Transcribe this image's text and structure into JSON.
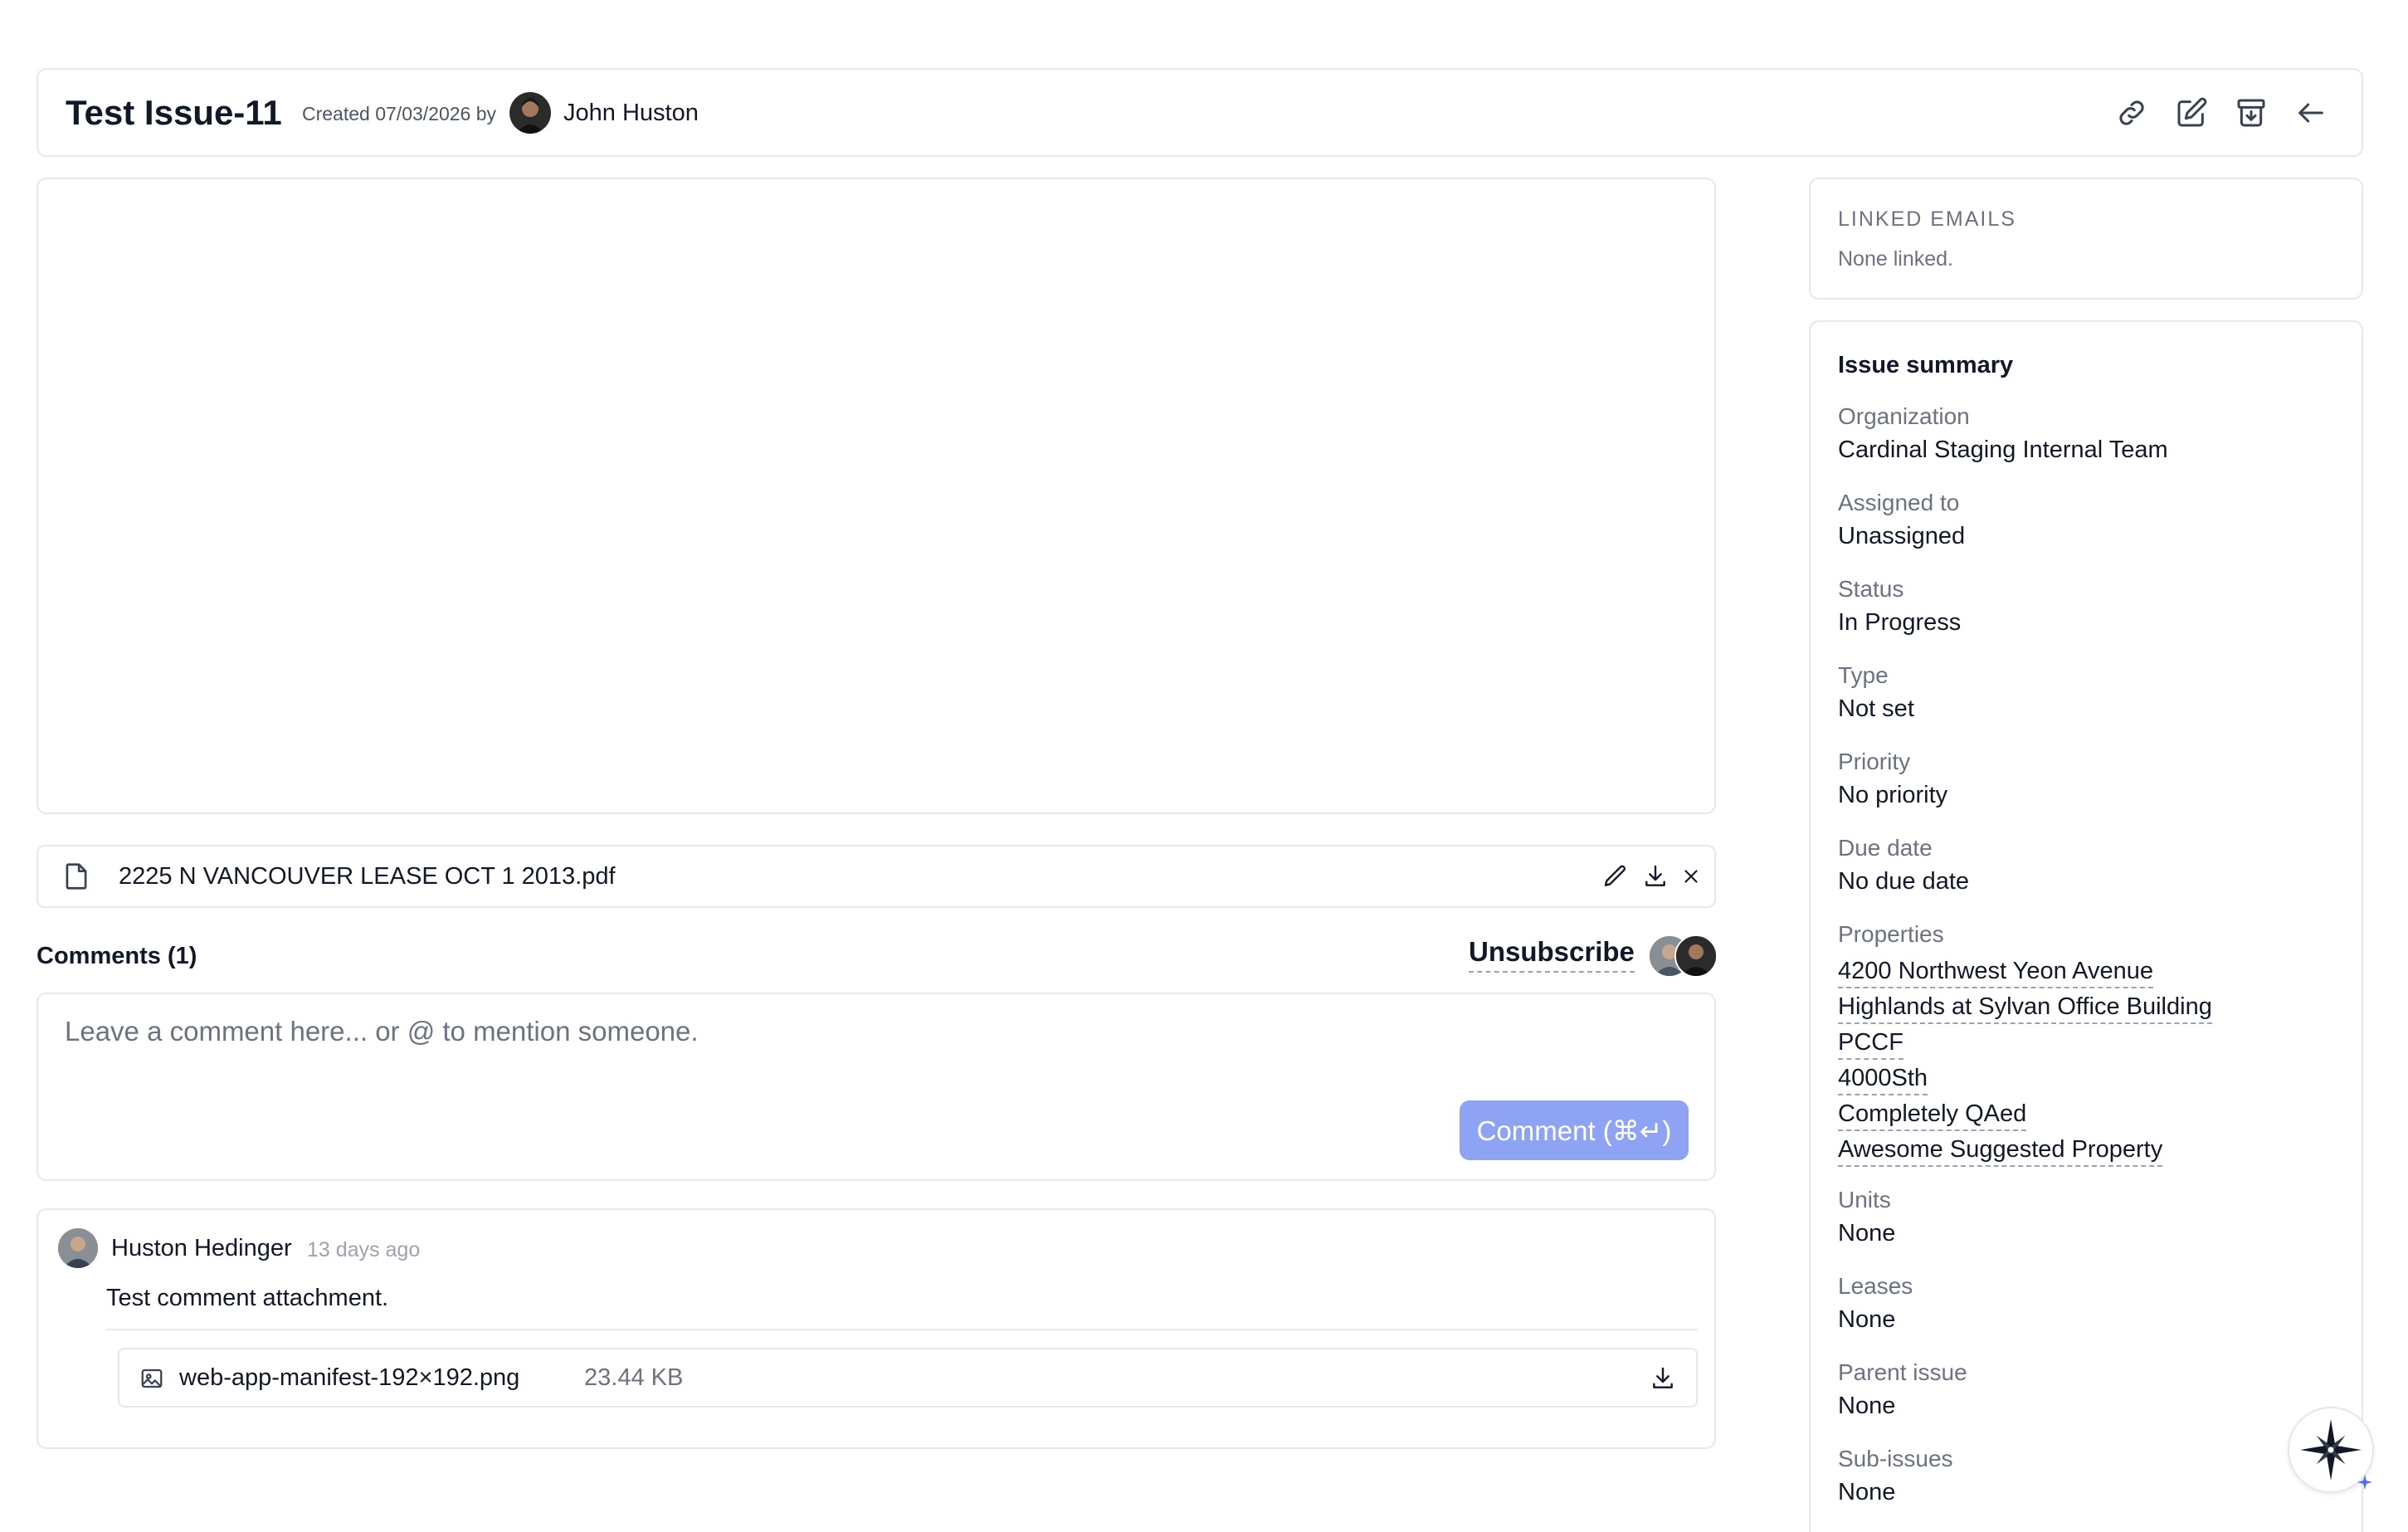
{
  "header": {
    "title": "Test Issue-11",
    "created_text": "Created 07/03/2026 by",
    "creator_name": "John Huston",
    "actions": {
      "copy_link": "link-icon",
      "edit": "edit-icon",
      "archive": "archive-icon",
      "back": "arrow-left-icon"
    }
  },
  "attachment": {
    "file_name": "2225 N VANCOUVER LEASE OCT 1 2013.pdf",
    "icon": "file-icon"
  },
  "comments": {
    "heading": "Comments (1)",
    "unsubscribe_label": "Unsubscribe",
    "placeholder": "Leave a comment here... or @ to mention someone.",
    "submit_label": "Comment (⌘↵)",
    "items": [
      {
        "author": "Huston Hedinger",
        "time": "13 days ago",
        "text": "Test comment attachment.",
        "attachment_name": "web-app-manifest-192×192.png",
        "attachment_size": "23.44 KB"
      }
    ]
  },
  "linked_emails": {
    "heading": "LINKED EMAILS",
    "empty_text": "None linked."
  },
  "summary": {
    "heading": "Issue summary",
    "organization_label": "Organization",
    "organization_value": "Cardinal Staging Internal Team",
    "assigned_label": "Assigned to",
    "assigned_value": "Unassigned",
    "status_label": "Status",
    "status_value": "In Progress",
    "type_label": "Type",
    "type_value": "Not set",
    "priority_label": "Priority",
    "priority_value": "No priority",
    "due_label": "Due date",
    "due_value": "No due date",
    "properties_label": "Properties",
    "properties": [
      "4200 Northwest Yeon Avenue",
      "Highlands at Sylvan Office Building",
      "PCCF",
      "4000Sth",
      "Completely QAed",
      "Awesome Suggested Property"
    ],
    "units_label": "Units",
    "units_value": "None",
    "leases_label": "Leases",
    "leases_value": "None",
    "parent_label": "Parent issue",
    "parent_value": "None",
    "subissues_label": "Sub-issues",
    "subissues_value": "None"
  },
  "colors": {
    "accent": "#8fa3f5",
    "border": "#e5e7eb",
    "muted_text": "#6b7280"
  },
  "assistant_button": {
    "icon": "compass-star-icon"
  }
}
